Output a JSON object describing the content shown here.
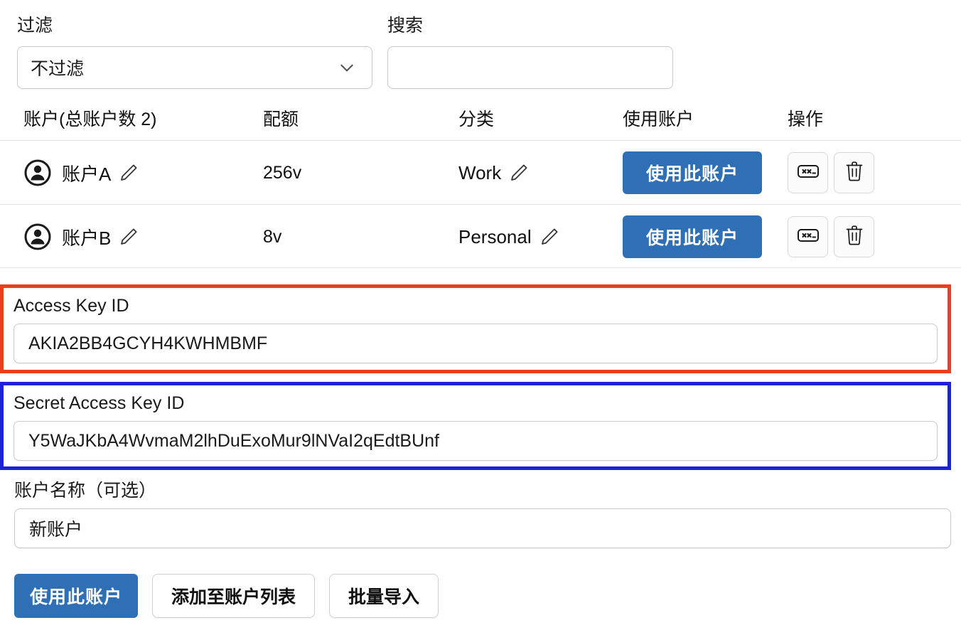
{
  "toolbar": {
    "filter": {
      "label": "过滤",
      "selected": "不过滤",
      "chevron_icon": "chevron-down-icon"
    },
    "search": {
      "label": "搜索",
      "value": "",
      "placeholder": ""
    }
  },
  "table": {
    "columns": {
      "account": "账户(总账户数 2)",
      "quota": "配额",
      "category": "分类",
      "use": "使用账户",
      "actions": "操作"
    },
    "rows": [
      {
        "avatar_icon": "person-circle-icon",
        "name": "账户A",
        "name_edit_icon": "pencil-icon",
        "quota": "256v",
        "category": "Work",
        "category_edit_icon": "pencil-icon",
        "use_label": "使用此账户",
        "password_icon": "password-field-icon",
        "delete_icon": "trash-icon"
      },
      {
        "avatar_icon": "person-circle-icon",
        "name": "账户B",
        "name_edit_icon": "pencil-icon",
        "quota": "8v",
        "category": "Personal",
        "category_edit_icon": "pencil-icon",
        "use_label": "使用此账户",
        "password_icon": "password-field-icon",
        "delete_icon": "trash-icon"
      }
    ]
  },
  "credentials": {
    "access_key": {
      "label": "Access Key ID",
      "value": "AKIA2BB4GCYH4KWHMBMF",
      "highlight_color": "#e8401f"
    },
    "secret_key": {
      "label": "Secret Access Key ID",
      "value": "Y5WaJKbA4WvmaM2lhDuExoMur9lNVaI2qEdtBUnf",
      "highlight_color": "#1e22d6"
    }
  },
  "account_name": {
    "label": "账户名称（可选）",
    "value": "新账户",
    "placeholder": ""
  },
  "footer": {
    "use_account": "使用此账户",
    "add_to_list": "添加至账户列表",
    "bulk_import": "批量导入"
  },
  "colors": {
    "primary_blue": "#2f6fb5",
    "highlight_red": "#e8401f",
    "highlight_blue": "#1e22d6",
    "border_gray": "#c9c9c9"
  }
}
